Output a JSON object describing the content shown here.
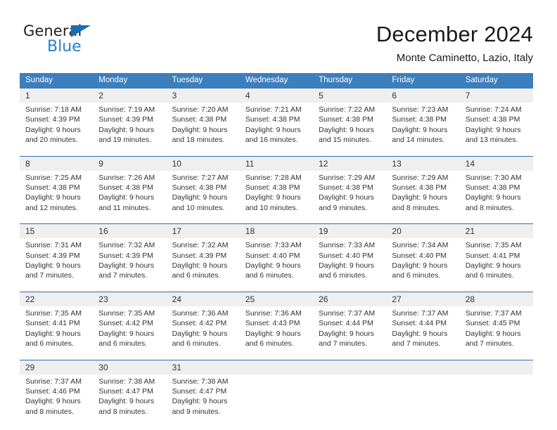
{
  "logo": {
    "word_one": "General",
    "word_two": "Blue",
    "triangle_color": "#1b6cb3",
    "blue_color": "#2283c7"
  },
  "header": {
    "title": "December 2024",
    "subtitle": "Monte Caminetto, Lazio, Italy"
  },
  "theme": {
    "header_blue": "#3d7ebc",
    "rule_blue": "#2f6caa",
    "day_band_gray": "#efefef",
    "text": "#333333"
  },
  "weekdays": [
    "Sunday",
    "Monday",
    "Tuesday",
    "Wednesday",
    "Thursday",
    "Friday",
    "Saturday"
  ],
  "weeks": [
    {
      "days": [
        {
          "num": "1",
          "sunrise": "Sunrise: 7:18 AM",
          "sunset": "Sunset: 4:39 PM",
          "daylight_1": "Daylight: 9 hours",
          "daylight_2": "and 20 minutes."
        },
        {
          "num": "2",
          "sunrise": "Sunrise: 7:19 AM",
          "sunset": "Sunset: 4:39 PM",
          "daylight_1": "Daylight: 9 hours",
          "daylight_2": "and 19 minutes."
        },
        {
          "num": "3",
          "sunrise": "Sunrise: 7:20 AM",
          "sunset": "Sunset: 4:38 PM",
          "daylight_1": "Daylight: 9 hours",
          "daylight_2": "and 18 minutes."
        },
        {
          "num": "4",
          "sunrise": "Sunrise: 7:21 AM",
          "sunset": "Sunset: 4:38 PM",
          "daylight_1": "Daylight: 9 hours",
          "daylight_2": "and 16 minutes."
        },
        {
          "num": "5",
          "sunrise": "Sunrise: 7:22 AM",
          "sunset": "Sunset: 4:38 PM",
          "daylight_1": "Daylight: 9 hours",
          "daylight_2": "and 15 minutes."
        },
        {
          "num": "6",
          "sunrise": "Sunrise: 7:23 AM",
          "sunset": "Sunset: 4:38 PM",
          "daylight_1": "Daylight: 9 hours",
          "daylight_2": "and 14 minutes."
        },
        {
          "num": "7",
          "sunrise": "Sunrise: 7:24 AM",
          "sunset": "Sunset: 4:38 PM",
          "daylight_1": "Daylight: 9 hours",
          "daylight_2": "and 13 minutes."
        }
      ]
    },
    {
      "days": [
        {
          "num": "8",
          "sunrise": "Sunrise: 7:25 AM",
          "sunset": "Sunset: 4:38 PM",
          "daylight_1": "Daylight: 9 hours",
          "daylight_2": "and 12 minutes."
        },
        {
          "num": "9",
          "sunrise": "Sunrise: 7:26 AM",
          "sunset": "Sunset: 4:38 PM",
          "daylight_1": "Daylight: 9 hours",
          "daylight_2": "and 11 minutes."
        },
        {
          "num": "10",
          "sunrise": "Sunrise: 7:27 AM",
          "sunset": "Sunset: 4:38 PM",
          "daylight_1": "Daylight: 9 hours",
          "daylight_2": "and 10 minutes."
        },
        {
          "num": "11",
          "sunrise": "Sunrise: 7:28 AM",
          "sunset": "Sunset: 4:38 PM",
          "daylight_1": "Daylight: 9 hours",
          "daylight_2": "and 10 minutes."
        },
        {
          "num": "12",
          "sunrise": "Sunrise: 7:29 AM",
          "sunset": "Sunset: 4:38 PM",
          "daylight_1": "Daylight: 9 hours",
          "daylight_2": "and 9 minutes."
        },
        {
          "num": "13",
          "sunrise": "Sunrise: 7:29 AM",
          "sunset": "Sunset: 4:38 PM",
          "daylight_1": "Daylight: 9 hours",
          "daylight_2": "and 8 minutes."
        },
        {
          "num": "14",
          "sunrise": "Sunrise: 7:30 AM",
          "sunset": "Sunset: 4:38 PM",
          "daylight_1": "Daylight: 9 hours",
          "daylight_2": "and 8 minutes."
        }
      ]
    },
    {
      "days": [
        {
          "num": "15",
          "sunrise": "Sunrise: 7:31 AM",
          "sunset": "Sunset: 4:39 PM",
          "daylight_1": "Daylight: 9 hours",
          "daylight_2": "and 7 minutes."
        },
        {
          "num": "16",
          "sunrise": "Sunrise: 7:32 AM",
          "sunset": "Sunset: 4:39 PM",
          "daylight_1": "Daylight: 9 hours",
          "daylight_2": "and 7 minutes."
        },
        {
          "num": "17",
          "sunrise": "Sunrise: 7:32 AM",
          "sunset": "Sunset: 4:39 PM",
          "daylight_1": "Daylight: 9 hours",
          "daylight_2": "and 6 minutes."
        },
        {
          "num": "18",
          "sunrise": "Sunrise: 7:33 AM",
          "sunset": "Sunset: 4:40 PM",
          "daylight_1": "Daylight: 9 hours",
          "daylight_2": "and 6 minutes."
        },
        {
          "num": "19",
          "sunrise": "Sunrise: 7:33 AM",
          "sunset": "Sunset: 4:40 PM",
          "daylight_1": "Daylight: 9 hours",
          "daylight_2": "and 6 minutes."
        },
        {
          "num": "20",
          "sunrise": "Sunrise: 7:34 AM",
          "sunset": "Sunset: 4:40 PM",
          "daylight_1": "Daylight: 9 hours",
          "daylight_2": "and 6 minutes."
        },
        {
          "num": "21",
          "sunrise": "Sunrise: 7:35 AM",
          "sunset": "Sunset: 4:41 PM",
          "daylight_1": "Daylight: 9 hours",
          "daylight_2": "and 6 minutes."
        }
      ]
    },
    {
      "days": [
        {
          "num": "22",
          "sunrise": "Sunrise: 7:35 AM",
          "sunset": "Sunset: 4:41 PM",
          "daylight_1": "Daylight: 9 hours",
          "daylight_2": "and 6 minutes."
        },
        {
          "num": "23",
          "sunrise": "Sunrise: 7:35 AM",
          "sunset": "Sunset: 4:42 PM",
          "daylight_1": "Daylight: 9 hours",
          "daylight_2": "and 6 minutes."
        },
        {
          "num": "24",
          "sunrise": "Sunrise: 7:36 AM",
          "sunset": "Sunset: 4:42 PM",
          "daylight_1": "Daylight: 9 hours",
          "daylight_2": "and 6 minutes."
        },
        {
          "num": "25",
          "sunrise": "Sunrise: 7:36 AM",
          "sunset": "Sunset: 4:43 PM",
          "daylight_1": "Daylight: 9 hours",
          "daylight_2": "and 6 minutes."
        },
        {
          "num": "26",
          "sunrise": "Sunrise: 7:37 AM",
          "sunset": "Sunset: 4:44 PM",
          "daylight_1": "Daylight: 9 hours",
          "daylight_2": "and 7 minutes."
        },
        {
          "num": "27",
          "sunrise": "Sunrise: 7:37 AM",
          "sunset": "Sunset: 4:44 PM",
          "daylight_1": "Daylight: 9 hours",
          "daylight_2": "and 7 minutes."
        },
        {
          "num": "28",
          "sunrise": "Sunrise: 7:37 AM",
          "sunset": "Sunset: 4:45 PM",
          "daylight_1": "Daylight: 9 hours",
          "daylight_2": "and 7 minutes."
        }
      ]
    },
    {
      "days": [
        {
          "num": "29",
          "sunrise": "Sunrise: 7:37 AM",
          "sunset": "Sunset: 4:46 PM",
          "daylight_1": "Daylight: 9 hours",
          "daylight_2": "and 8 minutes."
        },
        {
          "num": "30",
          "sunrise": "Sunrise: 7:38 AM",
          "sunset": "Sunset: 4:47 PM",
          "daylight_1": "Daylight: 9 hours",
          "daylight_2": "and 8 minutes."
        },
        {
          "num": "31",
          "sunrise": "Sunrise: 7:38 AM",
          "sunset": "Sunset: 4:47 PM",
          "daylight_1": "Daylight: 9 hours",
          "daylight_2": "and 9 minutes."
        },
        {
          "num": "",
          "sunrise": "",
          "sunset": "",
          "daylight_1": "",
          "daylight_2": ""
        },
        {
          "num": "",
          "sunrise": "",
          "sunset": "",
          "daylight_1": "",
          "daylight_2": ""
        },
        {
          "num": "",
          "sunrise": "",
          "sunset": "",
          "daylight_1": "",
          "daylight_2": ""
        },
        {
          "num": "",
          "sunrise": "",
          "sunset": "",
          "daylight_1": "",
          "daylight_2": ""
        }
      ]
    }
  ]
}
